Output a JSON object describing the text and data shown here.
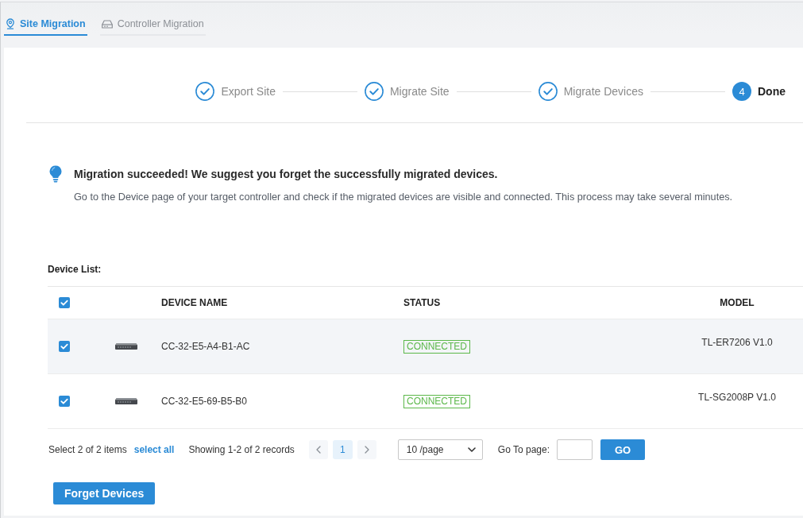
{
  "tabs": [
    {
      "label": "Site Migration",
      "kind": "site",
      "selected": true
    },
    {
      "label": "Controller Migration",
      "kind": "controller",
      "selected": false
    }
  ],
  "stepper": {
    "steps": [
      {
        "label": "Export Site",
        "kind": "done"
      },
      {
        "label": "Migrate Site",
        "kind": "done"
      },
      {
        "label": "Migrate Devices",
        "kind": "done"
      },
      {
        "label": "Done",
        "kind": "current",
        "number": "4"
      }
    ]
  },
  "notice": {
    "title": "Migration succeeded! We suggest you forget the successfully migrated devices.",
    "message": "Go to the Device page of your target controller and check if the migrated devices are visible and connected. This process may take several minutes."
  },
  "device_list": {
    "label": "Device List:",
    "all_checked": true,
    "columns": [
      "DEVICE NAME",
      "STATUS",
      "MODEL"
    ],
    "rows": [
      {
        "checked": true,
        "highlighted": true,
        "name": "CC-32-E5-A4-B1-AC",
        "status": "CONNECTED",
        "model": "TL-ER7206 V1.0"
      },
      {
        "checked": true,
        "highlighted": false,
        "name": "CC-32-E5-69-B5-B0",
        "status": "CONNECTED",
        "model": "TL-SG2008P V1.0"
      }
    ]
  },
  "pagination": {
    "selection": "Select 2 of 2 items",
    "select_all": "select all",
    "records": "Showing 1-2 of 2 records",
    "pages": [
      {
        "label": "1",
        "selected": true
      }
    ],
    "page_size": "10 /page",
    "goto_label": "Go To page:",
    "goto_button": "GO"
  },
  "forget_button": "Forget Devices"
}
